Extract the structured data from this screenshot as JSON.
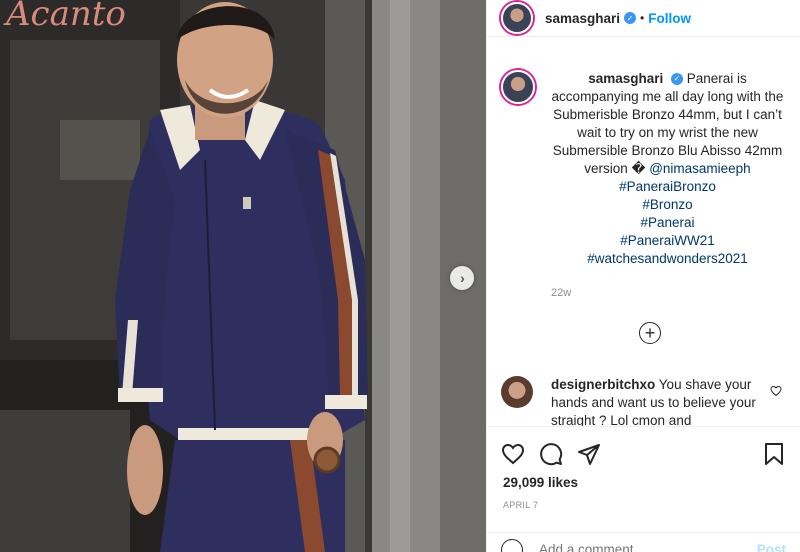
{
  "photo": {
    "sign_text": "Acanto",
    "next_icon": "chevron-right-icon"
  },
  "header": {
    "username": "samasghari",
    "verified_icon": "verified-badge-icon",
    "separator": "•",
    "follow_label": "Follow"
  },
  "caption": {
    "username": "samasghari",
    "text_before_mention": "Panerai is accompanying me all day long with the Submerisble Bronzo 44mm, but I can’t wait to try on my wrist the new Submersible Bronzo Blu Abisso 42mm version �",
    "mention": "@nimasamieeph",
    "hashtags": [
      "#PaneraiBronzo",
      "#Bronzo",
      "#Panerai",
      "#PaneraiWW21",
      "#watchesandwonders2021"
    ],
    "time": "22w"
  },
  "load_more_icon": "plus-circle-icon",
  "comment": {
    "username": "designerbitchxo",
    "text": "You shave your hands and want us to believe your straight ? Lol cmon and"
  },
  "actions": {
    "likes": "29,099 likes",
    "date": "APRIL 7"
  },
  "composer": {
    "placeholder": "Add a comment…",
    "post_label": "Post"
  },
  "colors": {
    "accent": "#0095f6",
    "verified": "#3897f0",
    "jacket": "#2e2f5e",
    "stripe_brown": "#8b4a2f"
  }
}
